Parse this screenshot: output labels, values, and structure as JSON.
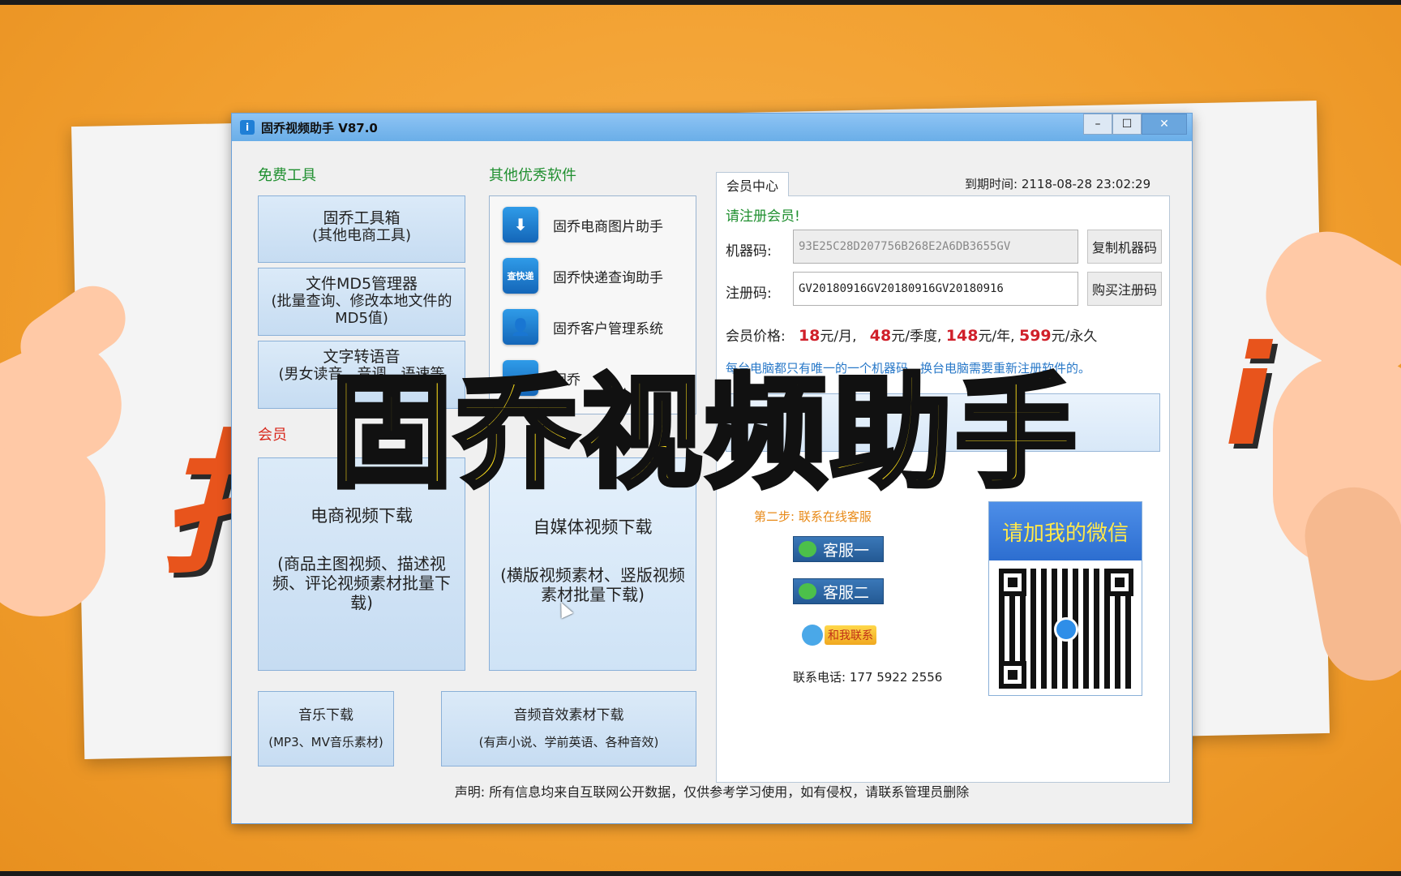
{
  "window": {
    "title": "固乔视频助手 V87.0",
    "app_icon": "info-icon",
    "controls": {
      "minimize": "–",
      "maximize": "☐",
      "close": "✕"
    }
  },
  "free_tools": {
    "label": "免费工具",
    "buttons": [
      {
        "line1": "固乔工具箱",
        "line2": "(其他电商工具)"
      },
      {
        "line1": "文件MD5管理器",
        "line2": "(批量查询、修改本地文件的MD5值)"
      },
      {
        "line1": "文字转语音",
        "line2": "(男女读音、音调、语速等"
      }
    ]
  },
  "other_software": {
    "label": "其他优秀软件",
    "items": [
      {
        "label": "固乔电商图片助手",
        "icon": "download-icon",
        "glyph": "⬇"
      },
      {
        "label": "固乔快递查询助手",
        "icon": "express-search-icon",
        "glyph": "查快递"
      },
      {
        "label": "固乔客户管理系统",
        "icon": "customer-icon",
        "glyph": "👤"
      },
      {
        "label": "固乔",
        "icon": "app-icon",
        "glyph": ""
      }
    ]
  },
  "member_tools": {
    "label": "会员",
    "buttons": [
      {
        "line1": "电商视频下载",
        "line2": "(商品主图视频、描述视频、评论视频素材批量下载)"
      },
      {
        "line1": "自媒体视频下载",
        "line2": "(横版视频素材、竖版视频素材批量下载)"
      },
      {
        "line1": "音乐下载",
        "line2": "(MP3、MV音乐素材)"
      },
      {
        "line1": "音频音效素材下载",
        "line2": "(有声小说、学前英语、各种音效)"
      }
    ]
  },
  "member_center": {
    "tab_label": "会员中心",
    "expire": "到期时间: 2118-08-28 23:02:29",
    "register_tip": "请注册会员!",
    "machine_code_label": "机器码:",
    "machine_code_value": "93E25C28D207756B268E2A6DB3655GV",
    "copy_machine_code": "复制机器码",
    "reg_code_label": "注册码:",
    "reg_code_value": "GV20180916GV20180916GV20180916",
    "buy_reg_code": "购买注册码",
    "price_label": "会员价格:",
    "prices": [
      {
        "num": "18",
        "unit": "元/月,"
      },
      {
        "num": "48",
        "unit": "元/季度,"
      },
      {
        "num": "148",
        "unit": "元/年,"
      },
      {
        "num": "599",
        "unit": "元/永久"
      }
    ],
    "notice": "每台电脑都只有唯一的一个机器码，换台电脑需要重新注册软件的。",
    "step_two": "第二步: 联系在线客服",
    "service_one": "客服一",
    "service_two": "客服二",
    "contact_me": "和我联系",
    "phone": "联系电话: 177 5922 2556",
    "wechat_head": "请加我的微信"
  },
  "disclaimer": "声明: 所有信息均来自互联网公开数据，仅供参考学习使用，如有侵权，请联系管理员删除",
  "overlay_title": "固乔视频助手",
  "colors": {
    "accent_green": "#1f8f2f",
    "price_red": "#d0202a",
    "overlay_yellow": "#ffe11a",
    "title_bar_blue": "#6aaee8"
  }
}
